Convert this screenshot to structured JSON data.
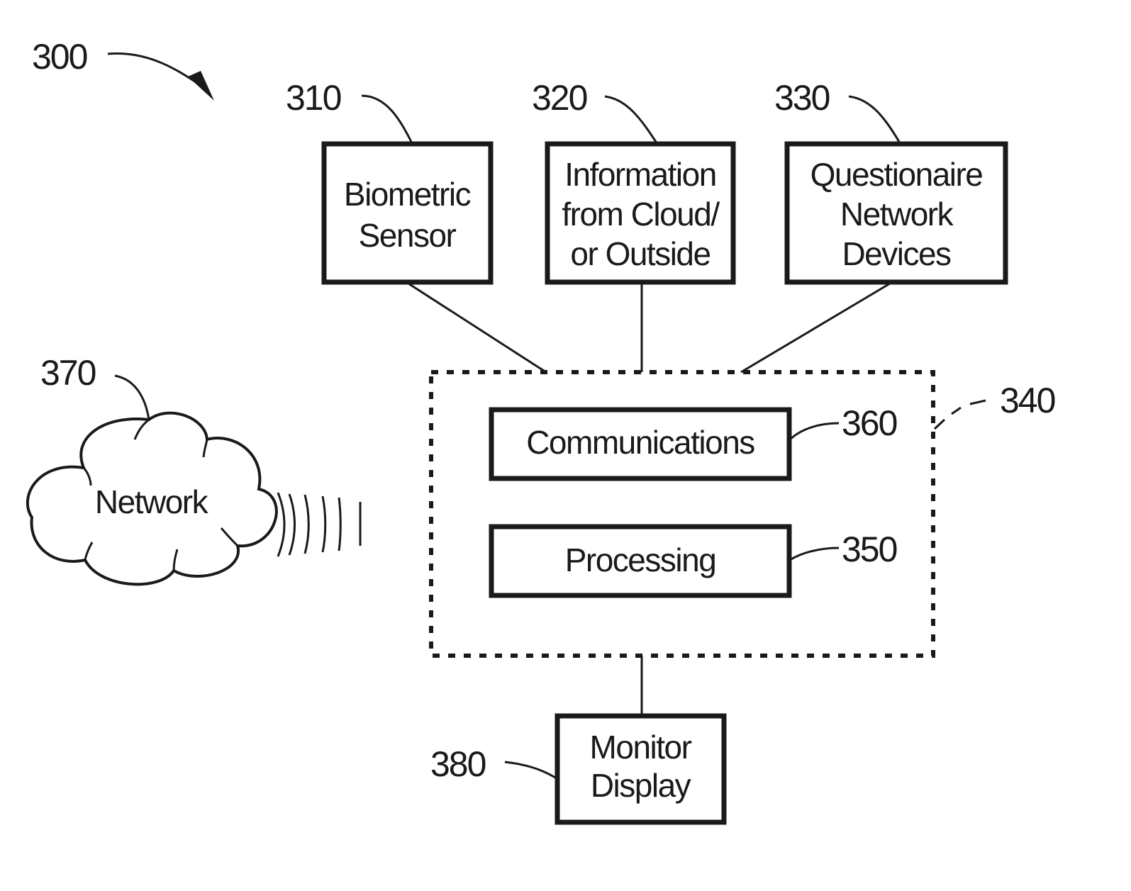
{
  "figure": {
    "ref": "300"
  },
  "blocks": {
    "biometric_sensor": {
      "ref": "310",
      "lines": [
        "Biometric",
        "Sensor"
      ]
    },
    "information_cloud": {
      "ref": "320",
      "lines": [
        "Information",
        "from Cloud/",
        "or Outside"
      ]
    },
    "questionnaire_devices": {
      "ref": "330",
      "lines": [
        "Questionaire",
        "Network",
        "Devices"
      ]
    },
    "device": {
      "ref": "340"
    },
    "processing": {
      "ref": "350",
      "label": "Processing"
    },
    "communications": {
      "ref": "360",
      "label": "Communications"
    },
    "network": {
      "ref": "370",
      "label": "Network"
    },
    "monitor_display": {
      "ref": "380",
      "lines": [
        "Monitor",
        "Display"
      ]
    }
  },
  "colors": {
    "ink": "#1a1a1a",
    "background": "#ffffff"
  }
}
